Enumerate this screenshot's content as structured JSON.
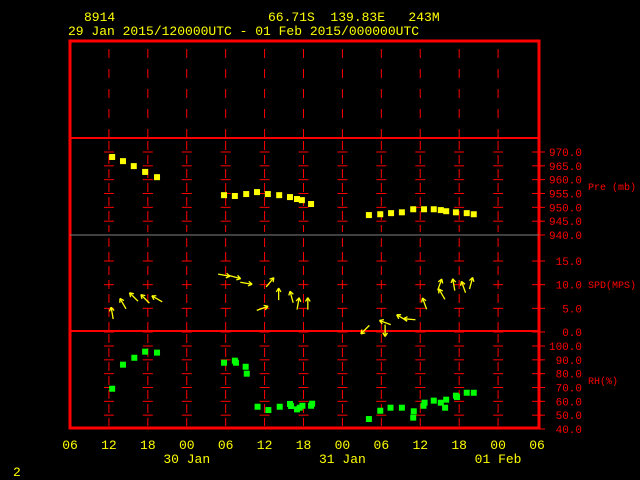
{
  "header": {
    "station_id": "8914",
    "location": "66.71S  139.83E   243M",
    "period": "29 Jan 2015/120000UTC - 01 Feb 2015/000000UTC"
  },
  "footer": {
    "page_number": "2"
  },
  "colors": {
    "frame": "#ff0000",
    "text": "#ffff00",
    "pressure": "#ffff00",
    "wind": "#ffff00",
    "rh": "#00ff00",
    "axis_labels": "#ff0000",
    "divider": "#808080"
  },
  "chart_data": {
    "type": "scatter",
    "x_axis": {
      "range": [
        "2015-01-29T06:00Z",
        "2015-02-01T06:00Z"
      ],
      "tick_labels": [
        "06",
        "12",
        "18",
        "00",
        "06",
        "12",
        "18",
        "00",
        "06",
        "12",
        "18",
        "00",
        "06"
      ],
      "date_labels": [
        {
          "label": "30 Jan",
          "at": "2015-01-30T00:00Z"
        },
        {
          "label": "31 Jan",
          "at": "2015-01-31T00:00Z"
        },
        {
          "label": "01 Feb",
          "at": "2015-02-01T00:00Z"
        }
      ]
    },
    "panels": [
      {
        "id": "pressure",
        "label": "Pre (mb)",
        "ylim": [
          940,
          970
        ],
        "ticks": [
          "970.0",
          "965.0",
          "960.0",
          "955.0",
          "950.0",
          "945.0",
          "940.0"
        ],
        "marker": "square",
        "points": [
          [
            "2015-01-29T12:30Z",
            968.2
          ],
          [
            "2015-01-29T14:10Z",
            966.7
          ],
          [
            "2015-01-29T15:50Z",
            964.9
          ],
          [
            "2015-01-29T17:35Z",
            962.8
          ],
          [
            "2015-01-29T19:25Z",
            960.9
          ],
          [
            "2015-01-30T05:45Z",
            954.4
          ],
          [
            "2015-01-30T07:25Z",
            954.1
          ],
          [
            "2015-01-30T09:10Z",
            954.8
          ],
          [
            "2015-01-30T10:50Z",
            955.5
          ],
          [
            "2015-01-30T12:30Z",
            954.8
          ],
          [
            "2015-01-30T14:15Z",
            954.4
          ],
          [
            "2015-01-30T15:55Z",
            953.7
          ],
          [
            "2015-01-30T17:00Z",
            953.0
          ],
          [
            "2015-01-30T17:45Z",
            952.6
          ],
          [
            "2015-01-30T19:10Z",
            951.2
          ],
          [
            "2015-01-31T04:05Z",
            947.2
          ],
          [
            "2015-01-31T05:50Z",
            947.5
          ],
          [
            "2015-01-31T07:30Z",
            947.9
          ],
          [
            "2015-01-31T09:10Z",
            948.2
          ],
          [
            "2015-01-31T10:55Z",
            949.3
          ],
          [
            "2015-01-31T12:35Z",
            949.3
          ],
          [
            "2015-01-31T14:05Z",
            949.3
          ],
          [
            "2015-01-31T15:10Z",
            949.0
          ],
          [
            "2015-01-31T16:00Z",
            948.6
          ],
          [
            "2015-01-31T17:30Z",
            948.2
          ],
          [
            "2015-01-31T19:10Z",
            947.9
          ],
          [
            "2015-01-31T20:15Z",
            947.5
          ]
        ]
      },
      {
        "id": "wind",
        "label": "SPD(MPS)",
        "ylim": [
          0,
          17
        ],
        "tick_values": [
          15,
          10,
          5,
          0
        ],
        "ticks": [
          "15.0",
          "10.0",
          "5.0",
          "0.0"
        ],
        "marker": "arrow (points in the direction the wind blows toward, compass degrees)",
        "points": [
          [
            "2015-01-29T12:30Z",
            4.0,
            350
          ],
          [
            "2015-01-29T14:10Z",
            6.0,
            330
          ],
          [
            "2015-01-29T15:50Z",
            7.4,
            315
          ],
          [
            "2015-01-29T17:35Z",
            7.0,
            315
          ],
          [
            "2015-01-29T19:25Z",
            7.0,
            300
          ],
          [
            "2015-01-30T05:45Z",
            12.0,
            100
          ],
          [
            "2015-01-30T07:25Z",
            11.6,
            105
          ],
          [
            "2015-01-30T09:10Z",
            10.3,
            100
          ],
          [
            "2015-01-30T11:40Z",
            5.0,
            70
          ],
          [
            "2015-01-30T12:50Z",
            10.5,
            40
          ],
          [
            "2015-01-30T14:10Z",
            8.0,
            0
          ],
          [
            "2015-01-30T16:10Z",
            7.4,
            345
          ],
          [
            "2015-01-30T17:10Z",
            6.0,
            10
          ],
          [
            "2015-01-30T18:40Z",
            6.0,
            0
          ],
          [
            "2015-01-31T03:30Z",
            0.5,
            225
          ],
          [
            "2015-01-31T06:35Z",
            0.3,
            180
          ],
          [
            "2015-01-31T06:35Z",
            2.0,
            290
          ],
          [
            "2015-01-31T09:10Z",
            3.0,
            300
          ],
          [
            "2015-01-31T10:20Z",
            2.7,
            275
          ],
          [
            "2015-01-31T12:40Z",
            6.0,
            340
          ],
          [
            "2015-01-31T15:00Z",
            10.0,
            20
          ],
          [
            "2015-01-31T15:20Z",
            8.0,
            330
          ],
          [
            "2015-01-31T17:10Z",
            10.0,
            350
          ],
          [
            "2015-01-31T18:40Z",
            9.5,
            340
          ],
          [
            "2015-01-31T19:50Z",
            10.3,
            15
          ]
        ]
      },
      {
        "id": "rh",
        "label": "RH(%)",
        "ylim": [
          40,
          100
        ],
        "ticks": [
          "100.0",
          "90.0",
          "80.0",
          "70.0",
          "60.0",
          "50.0",
          "40.0"
        ],
        "marker": "square",
        "points": [
          [
            "2015-01-29T12:30Z",
            69.1
          ],
          [
            "2015-01-29T14:10Z",
            86.5
          ],
          [
            "2015-01-29T15:55Z",
            91.5
          ],
          [
            "2015-01-29T17:35Z",
            95.9
          ],
          [
            "2015-01-29T19:25Z",
            95.2
          ],
          [
            "2015-01-30T05:45Z",
            87.9
          ],
          [
            "2015-01-30T07:25Z",
            89.4
          ],
          [
            "2015-01-30T07:35Z",
            87.9
          ],
          [
            "2015-01-30T09:05Z",
            85.0
          ],
          [
            "2015-01-30T09:15Z",
            80.0
          ],
          [
            "2015-01-30T10:55Z",
            56.1
          ],
          [
            "2015-01-30T12:35Z",
            53.7
          ],
          [
            "2015-01-30T14:20Z",
            56.1
          ],
          [
            "2015-01-30T15:55Z",
            58.1
          ],
          [
            "2015-01-30T16:05Z",
            56.6
          ],
          [
            "2015-01-30T17:00Z",
            54.2
          ],
          [
            "2015-01-30T17:25Z",
            55.4
          ],
          [
            "2015-01-30T17:50Z",
            56.8
          ],
          [
            "2015-01-30T19:10Z",
            56.8
          ],
          [
            "2015-01-30T19:20Z",
            58.3
          ],
          [
            "2015-01-31T04:05Z",
            47.2
          ],
          [
            "2015-01-31T05:50Z",
            53.2
          ],
          [
            "2015-01-31T07:25Z",
            55.4
          ],
          [
            "2015-01-31T09:10Z",
            55.4
          ],
          [
            "2015-01-31T10:55Z",
            48.2
          ],
          [
            "2015-01-31T11:00Z",
            52.8
          ],
          [
            "2015-01-31T12:30Z",
            56.8
          ],
          [
            "2015-01-31T12:40Z",
            59.0
          ],
          [
            "2015-01-31T14:05Z",
            60.5
          ],
          [
            "2015-01-31T15:10Z",
            59.0
          ],
          [
            "2015-01-31T15:50Z",
            55.4
          ],
          [
            "2015-01-31T16:00Z",
            61.2
          ],
          [
            "2015-01-31T17:30Z",
            64.1
          ],
          [
            "2015-01-31T17:40Z",
            63.1
          ],
          [
            "2015-01-31T19:10Z",
            66.2
          ],
          [
            "2015-01-31T20:15Z",
            66.2
          ]
        ]
      }
    ],
    "grid": true
  }
}
